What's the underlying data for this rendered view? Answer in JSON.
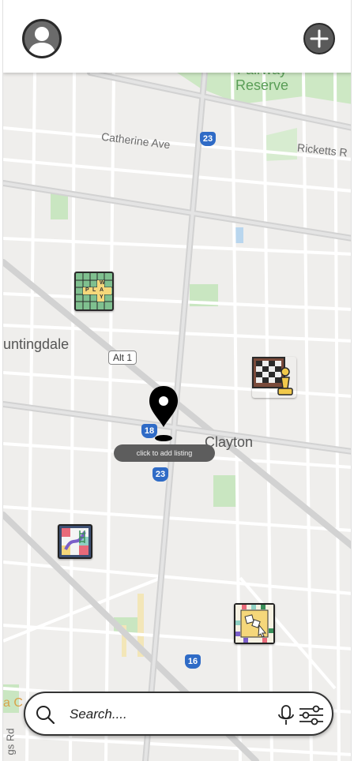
{
  "header": {
    "avatar_icon": "user-avatar-icon",
    "add_icon": "plus-circle-icon"
  },
  "map": {
    "labels": {
      "park": "Fairway\nReserve",
      "catherine": "Catherine Ave",
      "ricketts": "Ricketts R",
      "huntingdale": "untingdale",
      "clayton": "Clayton",
      "alt_route": "Alt 1",
      "route_23_top": "23",
      "route_18": "18",
      "route_23_mid": "23",
      "route_16": "16",
      "bottom_left_a": "a C",
      "bottom_left_rd": "gs Rd"
    },
    "markers": [
      {
        "name": "word-game-marker",
        "icon": "word-tiles-icon",
        "tiles": [
          "W",
          "P",
          "L",
          "A",
          "Y"
        ]
      },
      {
        "name": "chess-marker",
        "icon": "chess-board-icon"
      },
      {
        "name": "snakes-ladders-marker",
        "icon": "snakes-ladders-icon"
      },
      {
        "name": "monopoly-marker",
        "icon": "board-game-icon"
      }
    ],
    "pin_icon": "location-pin-icon",
    "tooltip": "click to add listing"
  },
  "search": {
    "placeholder": "Search....",
    "value": "",
    "search_icon": "search-icon",
    "mic_icon": "microphone-icon",
    "filter_icon": "filter-sliders-icon"
  },
  "colors": {
    "map_bg": "#efeeec",
    "road": "#ffffff",
    "major_road": "#cfcfcf",
    "park": "#c9e6c1",
    "route_shield": "#2f6bc6"
  }
}
